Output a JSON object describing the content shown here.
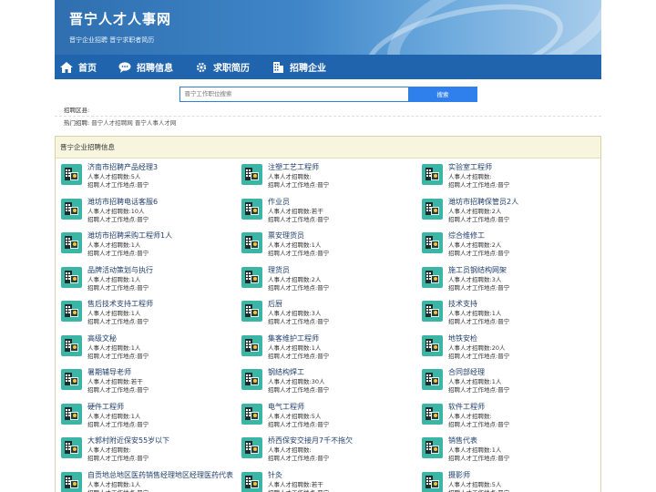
{
  "header": {
    "title": "晋宁人才人事网",
    "subtitle": "晋宁企业招聘 晋宁求职者简历"
  },
  "nav": [
    {
      "label": "首页",
      "icon": "home-icon"
    },
    {
      "label": "招聘信息",
      "icon": "chat-bubble-icon"
    },
    {
      "label": "求职简历",
      "icon": "gear-icon"
    },
    {
      "label": "招聘企业",
      "icon": "building-icon"
    }
  ],
  "search": {
    "placeholder": "晋宁工作职位搜索",
    "button": "搜索"
  },
  "filter": {
    "label": "招聘区县:"
  },
  "hot": {
    "label": "热门招聘:",
    "links": [
      "晋宁人才招聘网",
      "晋宁人事人才网"
    ]
  },
  "section": {
    "title": "晋宁企业招聘信息"
  },
  "colors": {
    "nav": "#1f64ad",
    "accent": "#2f80ed",
    "icon_bg": "#3bb6a6",
    "section_bg": "#f7f5de"
  },
  "jobs": [
    {
      "title": "济南市招聘产品经理3",
      "count": "人事人才招聘数:5人",
      "place": "招聘人才工作地点:晋宁"
    },
    {
      "title": "注塑工艺工程师",
      "count": "人事人才招聘数:",
      "place": "招聘人才工作地点:晋宁"
    },
    {
      "title": "实验室工程师",
      "count": "人事人才招聘数:",
      "place": "招聘人才工作地点:晋宁"
    },
    {
      "title": "潍坊市招聘电话客服6",
      "count": "人事人才招聘数:10人",
      "place": "招聘人才工作地点:晋宁"
    },
    {
      "title": "作业员",
      "count": "人事人才招聘数:若干",
      "place": "招聘人才工作地点:晋宁"
    },
    {
      "title": "潍坊市招聘保管员2人",
      "count": "人事人才招聘数:2人",
      "place": "招聘人才工作地点:晋宁"
    },
    {
      "title": "潍坊市招聘采购工程师1人",
      "count": "人事人才招聘数:1人",
      "place": "招聘人才工作地点:晋宁"
    },
    {
      "title": "票安理货员",
      "count": "人事人才招聘数:1人",
      "place": "招聘人才工作地点:晋宁"
    },
    {
      "title": "综合维修工",
      "count": "人事人才招聘数:2人",
      "place": "招聘人才工作地点:晋宁"
    },
    {
      "title": "品牌活动策划与执行",
      "count": "人事人才招聘数:1人",
      "place": "招聘人才工作地点:晋宁"
    },
    {
      "title": "理货员",
      "count": "人事人才招聘数:2人",
      "place": "招聘人才工作地点:晋宁"
    },
    {
      "title": "施工员钢结构网架",
      "count": "人事人才招聘数:3人",
      "place": "招聘人才工作地点:晋宁"
    },
    {
      "title": "售后技术支持工程师",
      "count": "人事人才招聘数:1人",
      "place": "招聘人才工作地点:晋宁"
    },
    {
      "title": "后厨",
      "count": "人事人才招聘数:3人",
      "place": "招聘人才工作地点:晋宁"
    },
    {
      "title": "技术支持",
      "count": "人事人才招聘数:1人",
      "place": "招聘人才工作地点:晋宁"
    },
    {
      "title": "高级文秘",
      "count": "人事人才招聘数:1人",
      "place": "招聘人才工作地点:晋宁"
    },
    {
      "title": "集客维护工程师",
      "count": "人事人才招聘数:1人",
      "place": "招聘人才工作地点:晋宁"
    },
    {
      "title": "地铁安检",
      "count": "人事人才招聘数:20人",
      "place": "招聘人才工作地点:晋宁"
    },
    {
      "title": "暑期辅导老师",
      "count": "人事人才招聘数:若干",
      "place": "招聘人才工作地点:晋宁"
    },
    {
      "title": "钢结构焊工",
      "count": "人事人才招聘数:30人",
      "place": "招聘人才工作地点:晋宁"
    },
    {
      "title": "合同部经理",
      "count": "人事人才招聘数:1人",
      "place": "招聘人才工作地点:晋宁"
    },
    {
      "title": "硬件工程师",
      "count": "人事人才招聘数:1人",
      "place": "招聘人才工作地点:晋宁"
    },
    {
      "title": "电气工程师",
      "count": "人事人才招聘数:5人",
      "place": "招聘人才工作地点:晋宁"
    },
    {
      "title": "软件工程师",
      "count": "人事人才招聘数:",
      "place": "招聘人才工作地点:晋宁"
    },
    {
      "title": "大郭村附近保安55岁以下",
      "count": "人事人才招聘数:",
      "place": "招聘人才工作地点:晋宁"
    },
    {
      "title": "桥西保安交接月7千不拖欠",
      "count": "人事人才招聘数:",
      "place": "招聘人才工作地点:晋宁"
    },
    {
      "title": "销售代表",
      "count": "人事人才招聘数:1人",
      "place": "招聘人才工作地点:晋宁"
    },
    {
      "title": "自贡地总地区医药销售经理地区经理医药代表",
      "count": "人事人才招聘数:1人",
      "place": "招聘人才工作地点:晋宁"
    },
    {
      "title": "针灸",
      "count": "人事人才招聘数:若干",
      "place": "招聘人才工作地点:晋宁"
    },
    {
      "title": "摄影师",
      "count": "人事人才招聘数:5人",
      "place": "招聘人才工作地点:晋宁"
    }
  ]
}
